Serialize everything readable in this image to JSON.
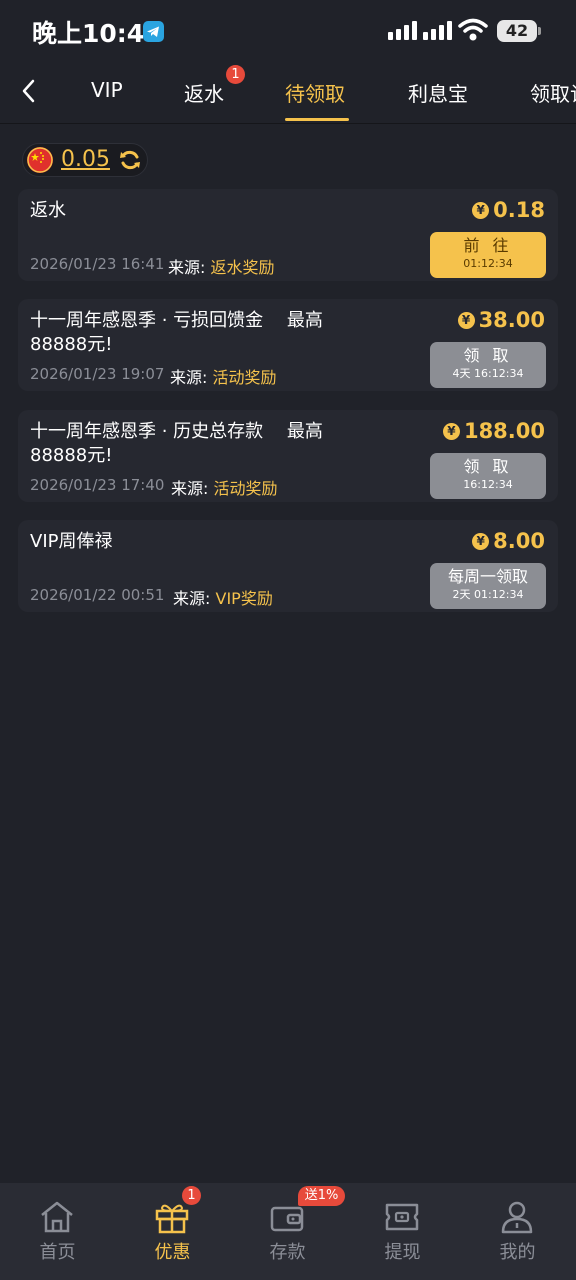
{
  "status_bar": {
    "time": "晚上10:47",
    "battery": "42"
  },
  "top_nav": {
    "tabs": [
      {
        "label": "VIP"
      },
      {
        "label": "返水",
        "badge": "1"
      },
      {
        "label": "待领取",
        "active": true
      },
      {
        "label": "利息宝"
      },
      {
        "label": "领取记"
      }
    ]
  },
  "balance": {
    "value": "0.05"
  },
  "rewards": [
    {
      "title": "返水",
      "amount": "0.18",
      "date": "2026/01/23 16:41",
      "source_label": "来源:",
      "source": "返水奖励",
      "button_label": "前 往",
      "button_timer": "01:12:34",
      "button_style": "gold"
    },
    {
      "title": "十一周年感恩季 · 亏损回馈金　 最高88888元!",
      "amount": "38.00",
      "date": "2026/01/23 19:07",
      "source_label": "来源:",
      "source": "活动奖励",
      "button_label": "领 取",
      "button_timer": "4天 16:12:34",
      "button_style": "gray"
    },
    {
      "title": "十一周年感恩季 · 历史总存款　 最高88888元!",
      "amount": "188.00",
      "date": "2026/01/23 17:40",
      "source_label": "来源:",
      "source": "活动奖励",
      "button_label": "领 取",
      "button_timer": "16:12:34",
      "button_style": "gray"
    },
    {
      "title": "VIP周俸禄",
      "amount": "8.00",
      "date": "2026/01/22 00:51",
      "source_label": "来源:",
      "source": "VIP奖励",
      "button_label": "每周一领取",
      "button_timer": "2天 01:12:34",
      "button_style": "gray"
    }
  ],
  "bottom_bar": {
    "items": [
      {
        "label": "首页",
        "icon": "home-icon"
      },
      {
        "label": "优惠",
        "icon": "gift-icon",
        "badge": "1",
        "active": true
      },
      {
        "label": "存款",
        "icon": "wallet-icon",
        "promo": "送1%"
      },
      {
        "label": "提现",
        "icon": "withdraw-icon"
      },
      {
        "label": "我的",
        "icon": "profile-icon"
      }
    ]
  },
  "colors": {
    "background": "#202229",
    "card": "#262830",
    "accent": "#f5c24c",
    "badge": "#e74a3b",
    "muted": "#8b8e97"
  }
}
